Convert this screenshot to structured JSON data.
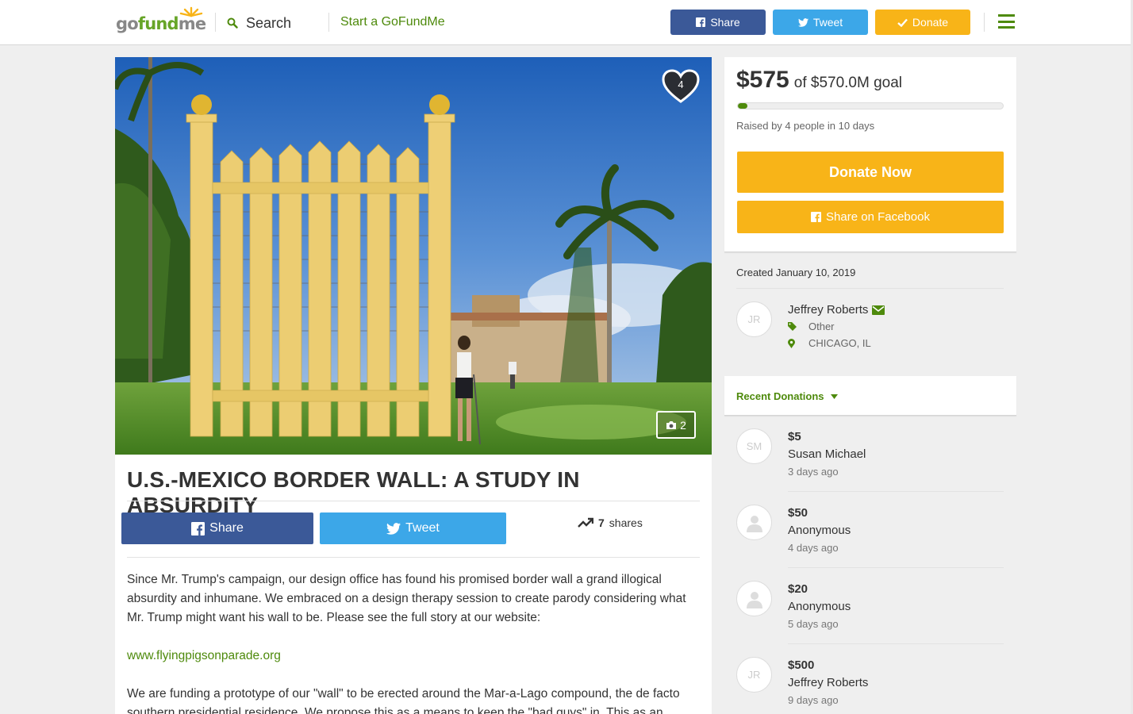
{
  "header": {
    "logo": "gofundme",
    "search_label": "Search",
    "start_label": "Start a GoFundMe",
    "share_label": "Share",
    "tweet_label": "Tweet",
    "donate_label": "Donate"
  },
  "campaign": {
    "title": "U.S.-MEXICO BORDER WALL: A STUDY IN ABSURDITY",
    "heart_count": "4",
    "photo_count": "2",
    "share_label": "Share",
    "tweet_label": "Tweet",
    "shares_count": "7",
    "shares_label": "shares",
    "story": [
      "Since Mr. Trump's campaign, our design office has found his promised border wall a grand illogical absurdity and inhumane.  We embraced on a design therapy session to create parody considering what Mr. Trump might want his wall to be. Please see the full story at our website:",
      "www.flyingpigsonparade.org",
      "We are funding a prototype of our \"wall\" to be erected around the Mar-a-Lago compound, the de facto southern presidential residence. We propose this as a means to keep the \"bad guys\" in. This as an"
    ]
  },
  "sidebar": {
    "raised_amount": "$575",
    "goal_text": "of $570.0M goal",
    "progress_fraction": 1e-06,
    "raised_by": "Raised by 4 people in 10 days",
    "donate_now_label": "Donate Now",
    "share_facebook_label": "Share on Facebook",
    "created": "Created January 10, 2019",
    "organizer": {
      "initials": "JR",
      "name": "Jeffrey Roberts",
      "category": "Other",
      "location": "CHICAGO, IL"
    },
    "recent_donations_label": "Recent Donations",
    "donations": [
      {
        "initials": "SM",
        "amount": "$5",
        "name": "Susan Michael",
        "time": "3 days ago"
      },
      {
        "initials": "",
        "amount": "$50",
        "name": "Anonymous",
        "time": "4 days ago"
      },
      {
        "initials": "",
        "amount": "$20",
        "name": "Anonymous",
        "time": "5 days ago"
      },
      {
        "initials": "JR",
        "amount": "$500",
        "name": "Jeffrey Roberts",
        "time": "9 days ago"
      }
    ]
  },
  "colors": {
    "brand_green": "#4e8a0c",
    "facebook": "#3b5998",
    "twitter": "#3ca7e8",
    "donate": "#f8b418"
  }
}
